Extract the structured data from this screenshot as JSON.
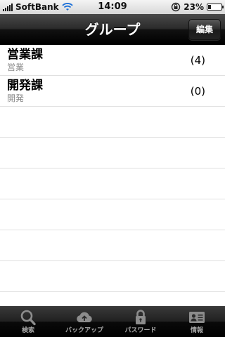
{
  "status_bar": {
    "carrier": "SoftBank",
    "time": "14:09",
    "battery_percent": "23%",
    "battery_level": 0.23
  },
  "nav": {
    "title": "グループ",
    "edit_label": "編集"
  },
  "groups": [
    {
      "name": "営業課",
      "sub": "営業",
      "count": "(4)"
    },
    {
      "name": "開発課",
      "sub": "開発",
      "count": "(0)"
    }
  ],
  "tabs": [
    {
      "label": "検索",
      "icon": "search-icon"
    },
    {
      "label": "バックアップ",
      "icon": "cloud-upload-icon"
    },
    {
      "label": "パスワード",
      "icon": "lock-icon"
    },
    {
      "label": "情報",
      "icon": "id-card-icon"
    }
  ]
}
